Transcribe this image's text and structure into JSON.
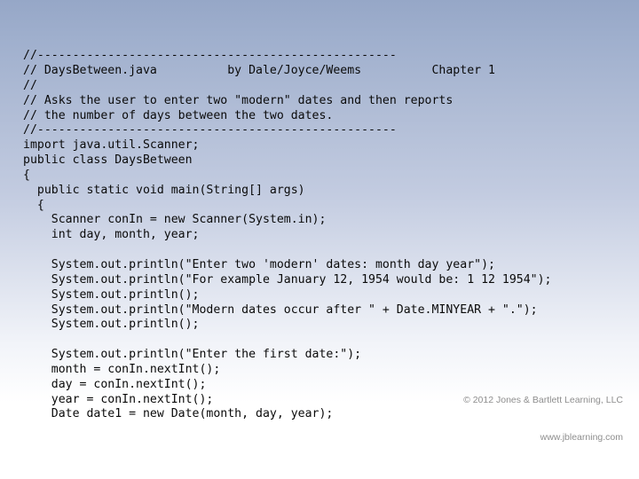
{
  "slide": {
    "background_top_color": "#96a7c7",
    "background_bottom_color": "#ffffff",
    "text_color": "#0a0a0a"
  },
  "code": {
    "language": "java",
    "file_name": "DaysBetween.java",
    "lines": [
      "//---------------------------------------------------",
      "// DaysBetween.java          by Dale/Joyce/Weems          Chapter 1",
      "//",
      "// Asks the user to enter two \"modern\" dates and then reports",
      "// the number of days between the two dates.",
      "//---------------------------------------------------",
      "import java.util.Scanner;",
      "public class DaysBetween",
      "{",
      "  public static void main(String[] args)",
      "  {",
      "    Scanner conIn = new Scanner(System.in);",
      "    int day, month, year;",
      "",
      "    System.out.println(\"Enter two 'modern' dates: month day year\");",
      "    System.out.println(\"For example January 12, 1954 would be: 1 12 1954\");",
      "    System.out.println();",
      "    System.out.println(\"Modern dates occur after \" + Date.MINYEAR + \".\");",
      "    System.out.println();",
      "",
      "    System.out.println(\"Enter the first date:\");",
      "    month = conIn.nextInt();",
      "    day = conIn.nextInt();",
      "    year = conIn.nextInt();",
      "    Date date1 = new Date(month, day, year);"
    ]
  },
  "footer": {
    "copyright": "© 2012 Jones & Bartlett Learning, LLC",
    "website": "www.jblearning.com",
    "color": "#8e8e8e"
  }
}
